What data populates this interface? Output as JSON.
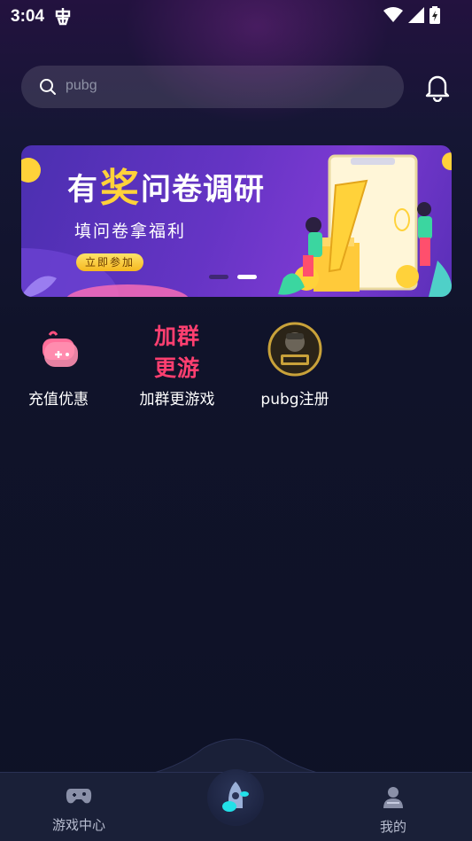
{
  "status_bar": {
    "time": "3:04"
  },
  "search": {
    "placeholder": "pubg"
  },
  "banner": {
    "title_pre": "有",
    "title_highlight": "奖",
    "title_post": "问卷调研",
    "subtitle": "填问卷拿福利",
    "button": "立即参加",
    "page_count": 2,
    "active_page": 2
  },
  "shortcuts": [
    {
      "label": "充值优惠",
      "icon": "gamepad-gift-icon"
    },
    {
      "label": "加群更游戏",
      "icon_text_line1": "加群",
      "icon_text_line2": "更游"
    },
    {
      "label": "pubg注册",
      "icon": "pubg-logo-icon"
    }
  ],
  "tabbar": {
    "tab_left": "游戏中心",
    "tab_right": "我的"
  },
  "colors": {
    "accent_yellow": "#ffd23a",
    "accent_pink": "#ff3f70",
    "tab_bg": "#1a2038"
  }
}
